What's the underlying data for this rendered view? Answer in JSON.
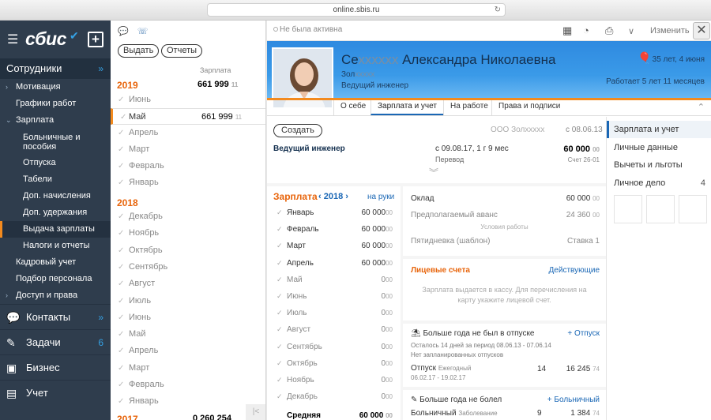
{
  "browser": {
    "url": "online.sbis.ru"
  },
  "nav": {
    "logo": "сбис",
    "section": "Сотрудники",
    "items": [
      {
        "label": "Мотивация",
        "arrow": true
      },
      {
        "label": "Графики работ",
        "arrow": false
      },
      {
        "label": "Зарплата",
        "arrow": true,
        "open": true
      },
      {
        "label": "Больничные и пособия",
        "sub": true,
        "wrap": true
      },
      {
        "label": "Отпуска",
        "sub": true
      },
      {
        "label": "Табели",
        "sub": true
      },
      {
        "label": "Доп. начисления",
        "sub": true
      },
      {
        "label": "Доп. удержания",
        "sub": true
      },
      {
        "label": "Выдача зарплаты",
        "sub": true,
        "active": true
      },
      {
        "label": "Налоги и отчеты",
        "sub": true
      },
      {
        "label": "Кадровый учет",
        "arrow": false
      },
      {
        "label": "Подбор персонала",
        "arrow": false
      },
      {
        "label": "Доступ и права",
        "arrow": true
      }
    ],
    "big": [
      {
        "label": "Контакты",
        "badge": "»"
      },
      {
        "label": "Задачи",
        "badge": "6"
      },
      {
        "label": "Бизнес",
        "badge": ""
      },
      {
        "label": "Учет",
        "badge": ""
      }
    ]
  },
  "col2": {
    "btn_issue": "Выдать",
    "btn_reports": "Отчеты",
    "col_head": "Зарплата",
    "year2019": "2019",
    "year2019_total": "661 999",
    "year2019_dec": "11",
    "months2019": [
      "Июнь",
      "Май",
      "Апрель",
      "Март",
      "Февраль",
      "Январь"
    ],
    "may_value": "661 999",
    "may_dec": "11",
    "year2018": "2018",
    "months2018": [
      "Декабрь",
      "Ноябрь",
      "Октябрь",
      "Сентябрь",
      "Август",
      "Июль",
      "Июнь",
      "Май",
      "Апрель",
      "Март",
      "Февраль",
      "Январь"
    ],
    "year2017": "2017",
    "year2017_total": "0 260 254"
  },
  "main": {
    "status": "Не была активна",
    "edit": "Изменить",
    "name_prefix": "Се",
    "name_masked": "хххххх",
    "name_rest": "Александра Николаевна",
    "org": "Зол",
    "org_masked": "ххххх",
    "position": "Ведущий инженер",
    "age": "35 лет, 4 июня",
    "worked": "Работает 5 лет 11 месяцев",
    "tabs": [
      "О себе",
      "Зарплата и учет",
      "На работе",
      "Права и подписи"
    ],
    "create": "Создать",
    "employer": "ООО Зол",
    "employer_masked": "ххххх",
    "employer_since": "с 08.06.13",
    "pos_title": "Ведущий инженер",
    "pos_date": "с 09.08.17, 1 г 9 мес",
    "pos_type": "Перевод",
    "pos_sum": "60 000",
    "pos_sum_dec": "00",
    "pos_account": "Счет 26-01",
    "zp_title": "Зарплата",
    "zp_year": "2018",
    "zp_hands": "на руки",
    "zp_rows": [
      {
        "month": "Январь",
        "value": "60 000",
        "dec": "00",
        "done": true
      },
      {
        "month": "Февраль",
        "value": "60 000",
        "dec": "00",
        "done": true
      },
      {
        "month": "Март",
        "value": "60 000",
        "dec": "00",
        "done": true
      },
      {
        "month": "Апрель",
        "value": "60 000",
        "dec": "00",
        "done": true
      },
      {
        "month": "Май",
        "value": "0",
        "dec": "00",
        "done": false
      },
      {
        "month": "Июнь",
        "value": "0",
        "dec": "00",
        "done": false
      },
      {
        "month": "Июль",
        "value": "0",
        "dec": "00",
        "done": false
      },
      {
        "month": "Август",
        "value": "0",
        "dec": "00",
        "done": false
      },
      {
        "month": "Сентябрь",
        "value": "0",
        "dec": "00",
        "done": false
      },
      {
        "month": "Октябрь",
        "value": "0",
        "dec": "00",
        "done": false
      },
      {
        "month": "Ноябрь",
        "value": "0",
        "dec": "00",
        "done": false
      },
      {
        "month": "Декабрь",
        "value": "0",
        "dec": "00",
        "done": false
      }
    ],
    "zp_total_label": "Средняя",
    "zp_total_value": "60 000",
    "zp_total_dec": "00",
    "oklad_label": "Оклад",
    "oklad_value": "60 000",
    "oklad_dec": "00",
    "advance_label": "Предполагаемый аванс",
    "advance_value": "24 360",
    "advance_dec": "00",
    "conditions": "Условия работы",
    "schedule_label": "Пятидневка (шаблон)",
    "schedule_rate": "Ставка 1",
    "acc_title": "Лицевые счета",
    "acc_link": "Действующие",
    "acc_note": "Зарплата выдается в кассу. Для перечисления на карту укажите лицевой счет.",
    "vac_title": "Больше года не был в отпуске",
    "vac_add": "Отпуск",
    "vac_left": "Осталось 14 дней за период 08.06.13 - 07.06.14",
    "vac_planned": "Нет запланированных отпусков",
    "vac_row": "Отпуск",
    "vac_kind": "Ежегодный",
    "vac_period": "06.02.17 - 19.02.17",
    "vac_days": "14",
    "vac_sum": "16 245",
    "vac_sum_dec": "74",
    "ill_title": "Больше года не болел",
    "ill_add": "Больничный",
    "ill_row": "Больничный",
    "ill_kind": "Заболевание",
    "ill_days": "9",
    "ill_sum": "1 384",
    "ill_sum_dec": "74",
    "right_items": [
      {
        "label": "Зарплата и учет",
        "count": ""
      },
      {
        "label": "Личные данные",
        "count": ""
      },
      {
        "label": "Вычеты и льготы",
        "count": ""
      },
      {
        "label": "Личное дело",
        "count": "4"
      }
    ]
  },
  "colors": {
    "nav_bg": "#2f3d4d",
    "accent": "#f38a1e",
    "link": "#1a67b5",
    "header_blue": "#3a9ae8"
  }
}
